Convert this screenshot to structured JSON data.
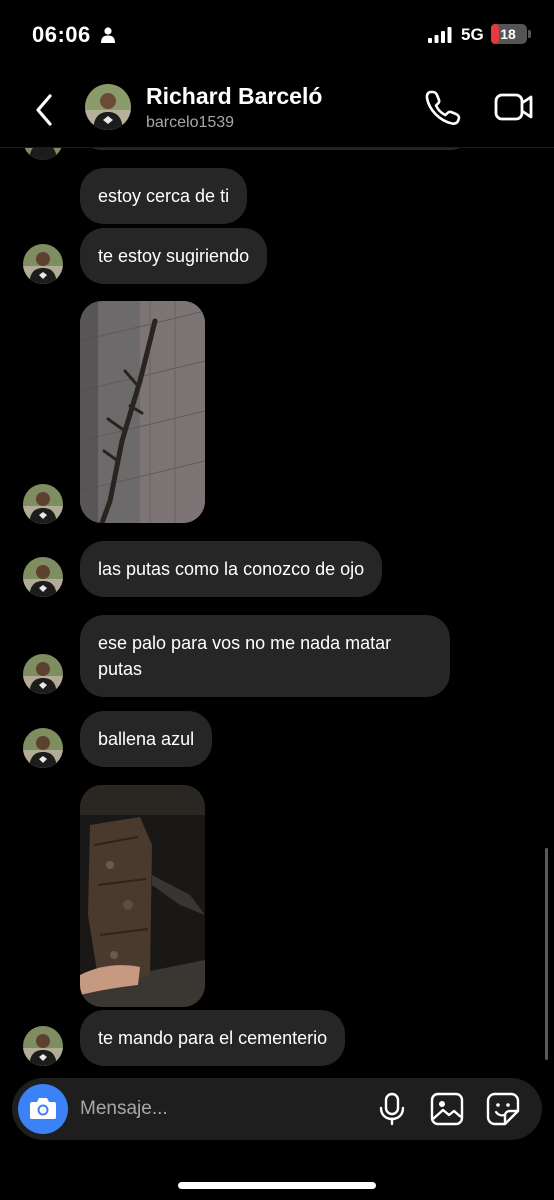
{
  "status_bar": {
    "time": "06:06",
    "network": "5G",
    "battery": "18",
    "battery_level": 0.18,
    "icons": [
      "person-icon",
      "signal-icon",
      "battery-icon"
    ]
  },
  "header": {
    "name": "Richard Barceló",
    "username": "barcelo1539",
    "icons": [
      "back-icon",
      "phone-icon",
      "video-camera-icon"
    ]
  },
  "messages": [
    {
      "type": "text",
      "text": "estoy cerca de ti"
    },
    {
      "type": "text",
      "text": "te estoy sugiriendo"
    },
    {
      "type": "image",
      "description": "photo"
    },
    {
      "type": "text",
      "text": "las putas como la conozco de ojo"
    },
    {
      "type": "text",
      "text": "ese palo para vos no me nada matar putas"
    },
    {
      "type": "text",
      "text": "ballena azul"
    },
    {
      "type": "image",
      "description": "photo"
    },
    {
      "type": "text",
      "text": "te mando para el cementerio"
    }
  ],
  "composer": {
    "placeholder": "Mensaje...",
    "icons": [
      "camera-icon",
      "microphone-icon",
      "gallery-icon",
      "sticker-icon"
    ]
  },
  "colors": {
    "background": "#000000",
    "bubble": "#262626",
    "accent": "#3b82f6",
    "battery_low": "#e5393f"
  }
}
